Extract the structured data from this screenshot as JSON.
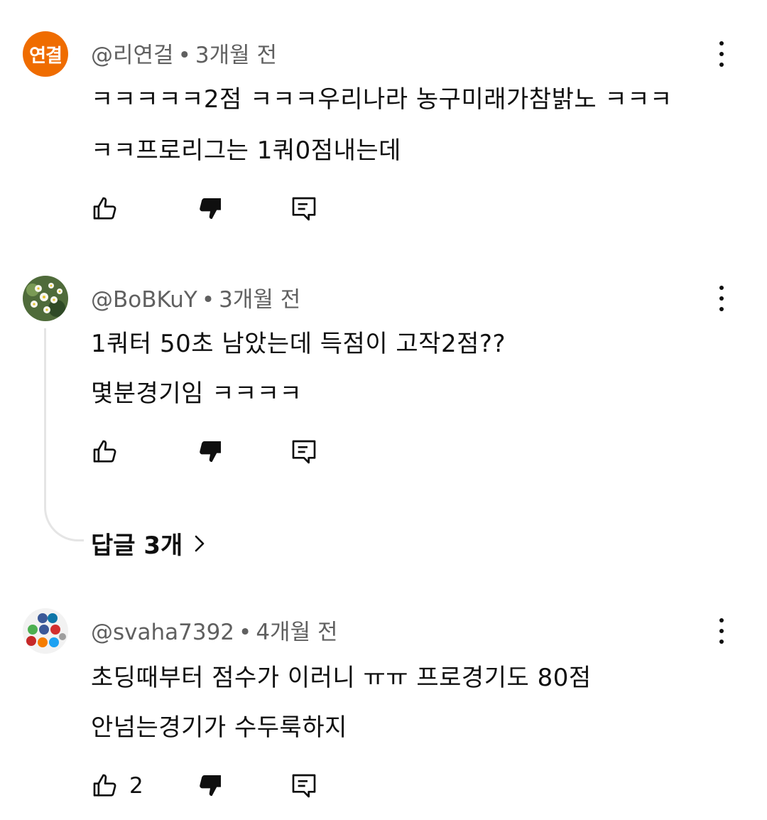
{
  "comments": [
    {
      "avatar_text": "연결",
      "avatar_color": "#ef6c00",
      "author": "@리연걸",
      "time": "3개월 전",
      "lines": [
        "ㅋㅋㅋㅋㅋ2점 ㅋㅋㅋ우리나라 농구미래가참밝노 ㅋㅋㅋ",
        "ㅋㅋ프로리그는 1쿼0점내는데"
      ],
      "likes": ""
    },
    {
      "avatar_text": "",
      "author": "@BoBKuY",
      "time": "3개월 전",
      "lines": [
        "1쿼터 50초 남았는데 득점이 고작2점??",
        "몇분경기임 ㅋㅋㅋㅋ"
      ],
      "likes": "",
      "replies_label": "답글 3개"
    },
    {
      "avatar_text": "",
      "author": "@svaha7392",
      "time": "4개월 전",
      "lines": [
        "초딩때부터 점수가 이러니 ㅠㅠ 프로경기도 80점",
        "안넘는경기가 수두룩하지"
      ],
      "likes": "2"
    }
  ],
  "separator": "•",
  "icons": {
    "like": "thumbs-up-icon",
    "dislike": "thumbs-down-icon",
    "reply": "reply-comment-icon",
    "menu": "more-vertical-icon",
    "replies_chevron": "chevron-right-icon"
  }
}
